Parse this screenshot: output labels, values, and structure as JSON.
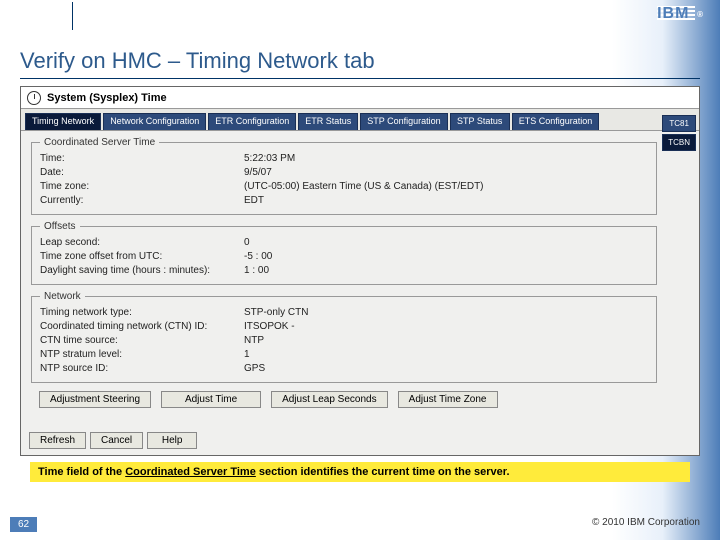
{
  "brand": "IBM",
  "slide": {
    "title": "Verify on HMC – Timing Network tab",
    "caption_prefix": "Time",
    "caption_mid": " field of the ",
    "caption_u": "Coordinated Server Time",
    "caption_suffix": " section identifies the current time on the server."
  },
  "panel": {
    "title": "System (Sysplex) Time",
    "tabs": [
      "Timing Network",
      "Network Configuration",
      "ETR Configuration",
      "ETR Status",
      "STP Configuration",
      "STP Status",
      "ETS Configuration"
    ],
    "side_tabs": [
      "TC81",
      "TCBN"
    ],
    "groups": {
      "cst": {
        "legend": "Coordinated Server Time",
        "rows": [
          {
            "label": "Time:",
            "value": "5:22:03 PM"
          },
          {
            "label": "Date:",
            "value": "9/5/07"
          },
          {
            "label": "Time zone:",
            "value": "(UTC-05:00) Eastern Time (US & Canada) (EST/EDT)"
          },
          {
            "label": "Currently:",
            "value": "EDT"
          }
        ]
      },
      "offsets": {
        "legend": "Offsets",
        "rows": [
          {
            "label": "Leap second:",
            "value": "0"
          },
          {
            "label": "Time zone offset from UTC:",
            "value": "-5 : 00"
          },
          {
            "label": "Daylight saving time (hours : minutes):",
            "value": "1 : 00"
          }
        ]
      },
      "network": {
        "legend": "Network",
        "rows": [
          {
            "label": "Timing network type:",
            "value": "STP-only CTN"
          },
          {
            "label": "Coordinated timing network (CTN) ID:",
            "value": "ITSOPOK -"
          },
          {
            "label": "CTN time source:",
            "value": "NTP"
          },
          {
            "label": "NTP stratum level:",
            "value": "1"
          },
          {
            "label": "NTP source ID:",
            "value": "GPS"
          }
        ]
      }
    },
    "action_buttons": [
      "Adjustment Steering",
      "Adjust Time",
      "Adjust Leap Seconds",
      "Adjust Time Zone"
    ],
    "bottom_buttons": [
      "Refresh",
      "Cancel",
      "Help"
    ]
  },
  "footer": {
    "page": "62",
    "copyright": "© 2010 IBM Corporation"
  }
}
